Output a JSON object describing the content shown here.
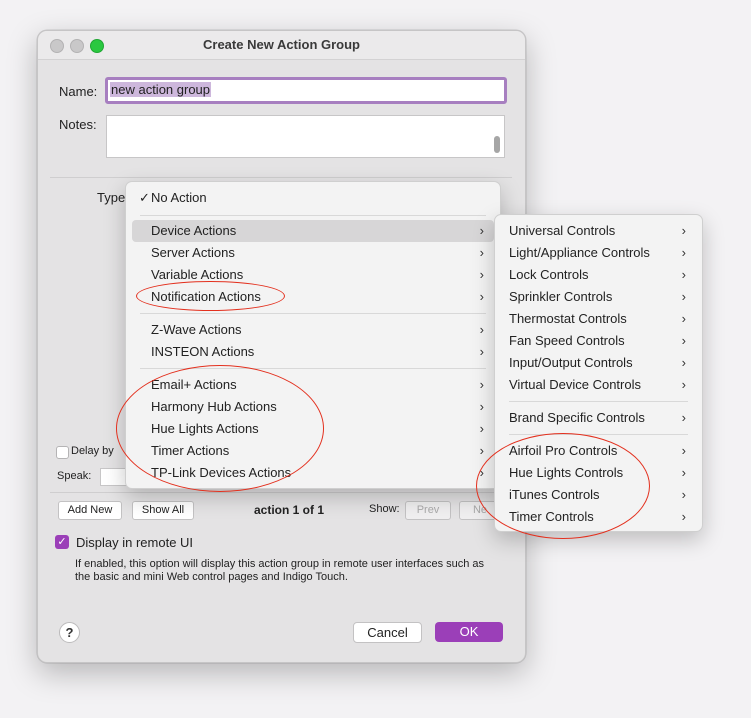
{
  "window": {
    "title": "Create New Action Group",
    "name_label": "Name:",
    "name_value": "new action group",
    "notes_label": "Notes:",
    "type_label": "Type",
    "delay_label": "Delay by",
    "speak_label": "Speak:",
    "add_new": "Add New",
    "show_all": "Show All",
    "action_counter": "action 1 of 1",
    "show_label": "Show:",
    "prev": "Prev",
    "next": "Ne",
    "display_remote_label": "Display in remote UI",
    "display_remote_checked": true,
    "description": "If enabled, this option will display this action group in remote user interfaces such as the basic and mini Web control pages and Indigo Touch.",
    "help": "?",
    "cancel": "Cancel",
    "ok": "OK"
  },
  "type_menu": {
    "checked_item": "No Action",
    "groups": [
      [
        "Device Actions",
        "Server Actions",
        "Variable Actions",
        "Notification Actions"
      ],
      [
        "Z-Wave Actions",
        "INSTEON Actions"
      ],
      [
        "Email+ Actions",
        "Harmony Hub Actions",
        "Hue Lights Actions",
        "Timer Actions",
        "TP-Link Devices Actions"
      ]
    ],
    "highlighted": "Device Actions"
  },
  "submenu": {
    "groups": [
      [
        "Universal Controls",
        "Light/Appliance Controls",
        "Lock Controls",
        "Sprinkler Controls",
        "Thermostat Controls",
        "Fan Speed Controls",
        "Input/Output Controls",
        "Virtual Device Controls"
      ],
      [
        "Brand Specific Controls"
      ],
      [
        "Airfoil Pro Controls",
        "Hue Lights Controls",
        "iTunes Controls",
        "Timer Controls"
      ]
    ]
  },
  "colors": {
    "accent": "#9b3fb8",
    "annotation": "#e3301e"
  }
}
